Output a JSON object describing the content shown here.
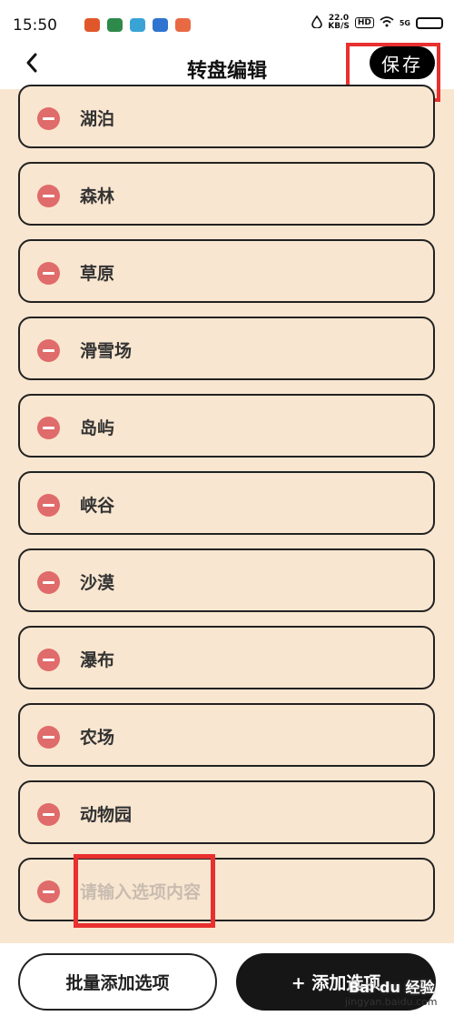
{
  "status_bar": {
    "time": "15:50",
    "net_speed": "22.0",
    "net_unit": "KB/S",
    "hd": "HD",
    "signal": "5G",
    "app_icons": [
      {
        "name": "app-icon-1",
        "color": "#e0582a"
      },
      {
        "name": "app-icon-2",
        "color": "#2e8a4a"
      },
      {
        "name": "app-icon-3",
        "color": "#3aa3d5"
      },
      {
        "name": "app-icon-4",
        "color": "#2f74d0"
      },
      {
        "name": "app-icon-5",
        "color": "#e86a45"
      }
    ]
  },
  "header": {
    "title": "转盘编辑",
    "save_label": "保存"
  },
  "options": [
    {
      "label": "湖泊"
    },
    {
      "label": "森林"
    },
    {
      "label": "草原"
    },
    {
      "label": "滑雪场"
    },
    {
      "label": "岛屿"
    },
    {
      "label": "峡谷"
    },
    {
      "label": "沙漠"
    },
    {
      "label": "瀑布"
    },
    {
      "label": "农场"
    },
    {
      "label": "动物园"
    }
  ],
  "new_option": {
    "placeholder": "请输入选项内容"
  },
  "footer": {
    "batch_add_label": "批量添加选项",
    "add_label": "+ 添加选项"
  },
  "watermark": {
    "text": "Bai du 经验",
    "url": "jingyan.baidu.com"
  },
  "colors": {
    "background": "#f9e6d0",
    "minus": "#e06b6b",
    "highlight": "#e8302f",
    "primary": "#000000"
  }
}
